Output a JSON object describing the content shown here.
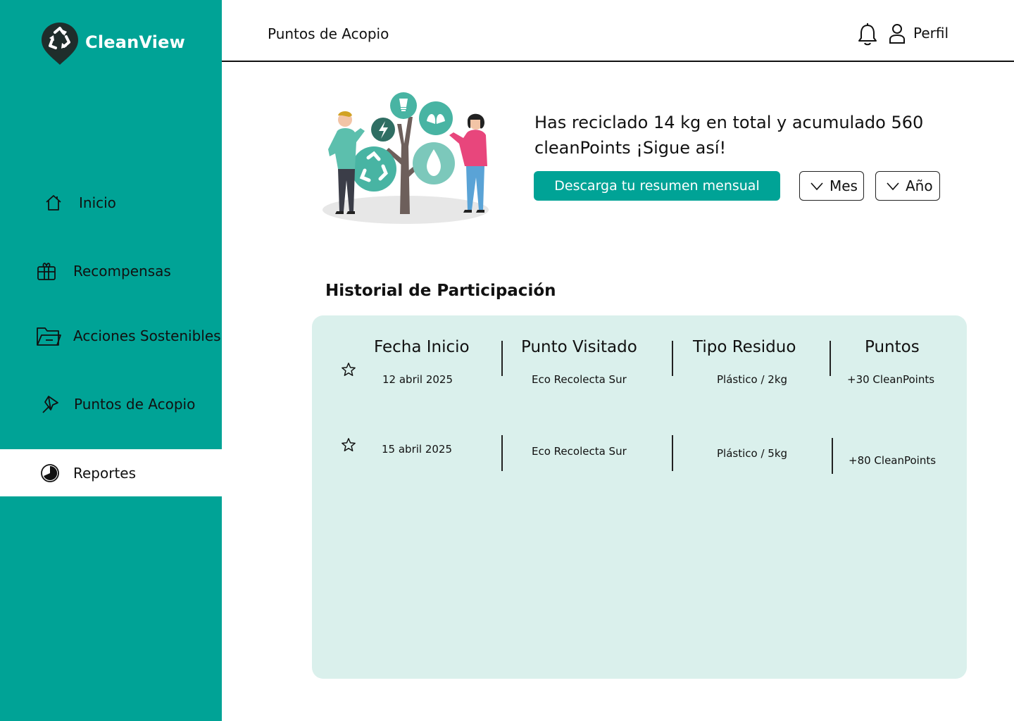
{
  "app": {
    "name": "CleanView"
  },
  "sidebar": {
    "items": [
      {
        "label": "Inicio",
        "icon": "home-icon"
      },
      {
        "label": "Recompensas",
        "icon": "gift-icon"
      },
      {
        "label": "Acciones Sostenibles",
        "icon": "folder-icon"
      },
      {
        "label": "Puntos de Acopio",
        "icon": "pin-icon"
      },
      {
        "label": "Reportes",
        "icon": "pie-chart-icon",
        "active": true
      }
    ]
  },
  "header": {
    "title": "Puntos de Acopio",
    "profile_label": "Perfil"
  },
  "hero": {
    "summary_line1": "Has reciclado 14 kg en total y acumulado 560",
    "summary_line2": "cleanPoints  ¡Sigue así!",
    "download_label": "Descarga tu resumen mensual",
    "month_label": "Mes",
    "year_label": "Año"
  },
  "history": {
    "title": "Historial de Participación",
    "columns": [
      "Fecha Inicio",
      "Punto Visitado",
      "Tipo Residuo",
      "Puntos"
    ],
    "rows": [
      {
        "date": "12 abril 2025",
        "place": "Eco Recolecta Sur",
        "waste": "Plástico / 2kg",
        "points": "+30 CleanPoints"
      },
      {
        "date": "15 abril 2025",
        "place": "Eco Recolecta Sur",
        "waste": "Plástico / 5kg",
        "points": "+80 CleanPoints"
      }
    ]
  },
  "colors": {
    "brand": "#00a396",
    "panel": "#daf0ec",
    "text": "#111111"
  }
}
